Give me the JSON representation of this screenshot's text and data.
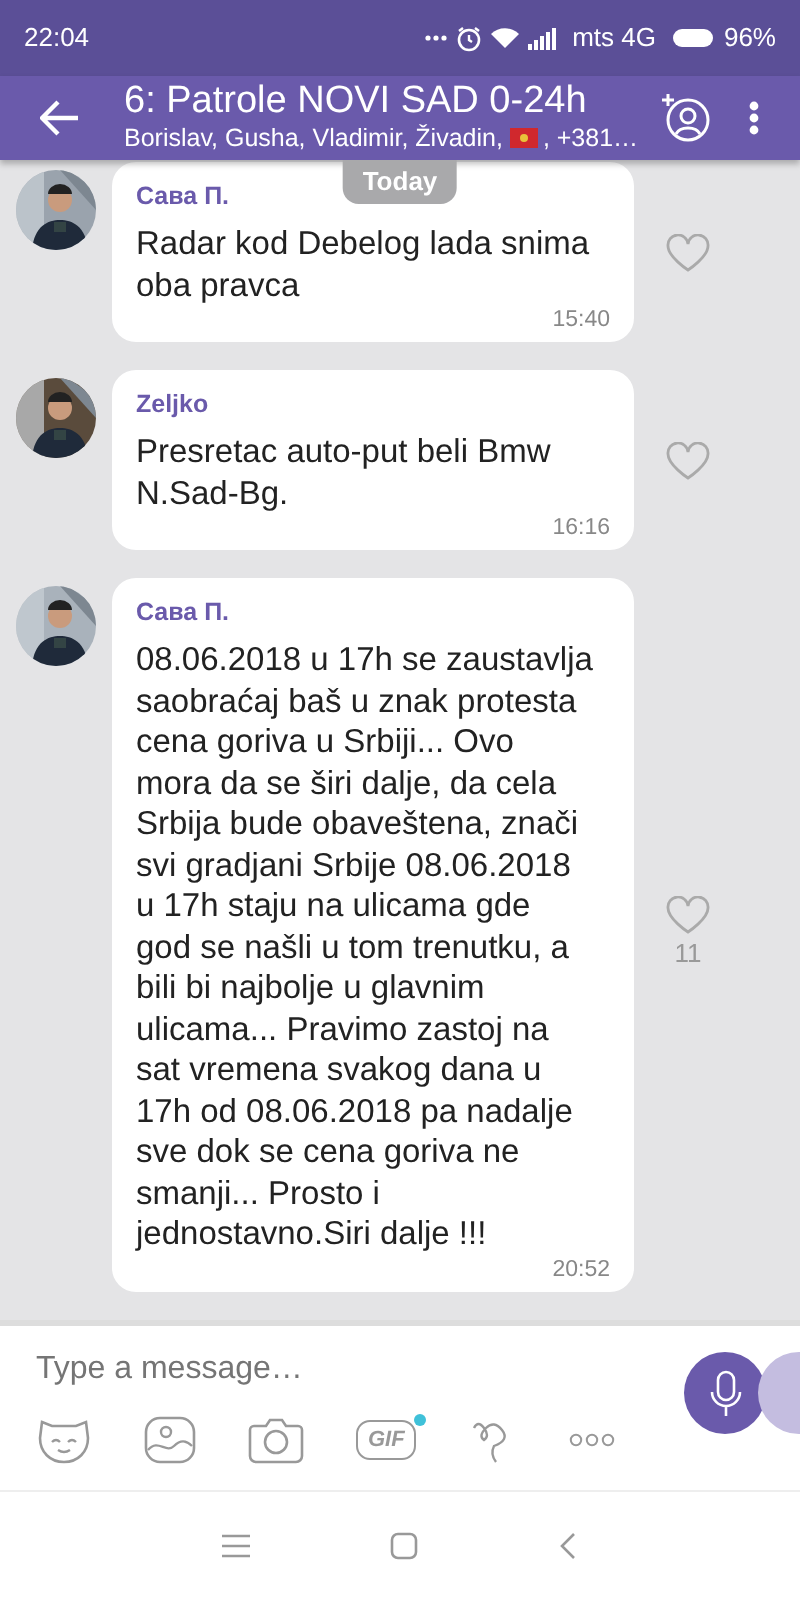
{
  "status_bar": {
    "time": "22:04",
    "carrier": "mts 4G",
    "battery": "96%"
  },
  "header": {
    "title": "6: Patrole NOVI SAD 0-24h",
    "members_before_flag": "Borislav, Gusha, Vladimir, Živadin,",
    "members_after_flag": ", +381…"
  },
  "date_badge": "Today",
  "messages": [
    {
      "sender": "Сава П.",
      "text": "Radar kod Debelog lada snima oba pravca",
      "time": "15:40"
    },
    {
      "sender": "Zeljko",
      "text": "Presretac auto-put beli Bmw N.Sad-Bg.",
      "time": "16:16"
    },
    {
      "sender": "Сава П.",
      "text": "08.06.2018 u 17h se zaustavlja saobraćaj baš u znak protesta cena goriva u Srbiji... Ovo mora da se širi dalje, da cela Srbija bude obaveštena, znači svi gradjani Srbije 08.06.2018 u 17h staju na ulicama gde god se našli u tom trenutku, a bili bi najbolje u glavnim ulicama... Pravimo zastoj na sat vremena svakog dana u 17h od 08.06.2018 pa nadalje sve dok se cena goriva ne smanji... Prosto i jednostavno.Siri dalje !!!",
      "time": "20:52",
      "likes": "11"
    }
  ],
  "composer": {
    "placeholder": "Type a message…",
    "gif_label": "GIF",
    "gif_new": true
  }
}
